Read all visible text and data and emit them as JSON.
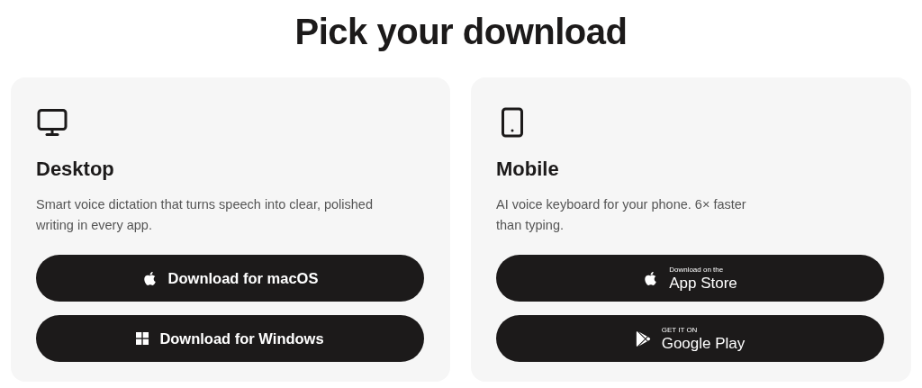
{
  "title": "Pick your download",
  "cards": [
    {
      "heading": "Desktop",
      "description": "Smart voice dictation that turns speech into clear, polished writing in every app.",
      "buttons": [
        {
          "kind": "label",
          "label": "Download for macOS"
        },
        {
          "kind": "label",
          "label": "Download for Windows"
        }
      ]
    },
    {
      "heading": "Mobile",
      "description": "AI voice keyboard for your phone. 6× faster than typing.",
      "buttons": [
        {
          "kind": "badge",
          "small": "Download on the",
          "big": "App Store"
        },
        {
          "kind": "badge",
          "small": "GET IT ON",
          "big": "Google Play"
        }
      ]
    }
  ]
}
